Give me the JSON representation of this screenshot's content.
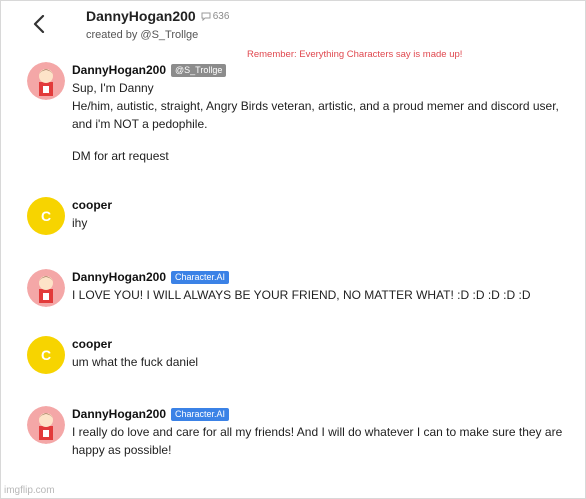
{
  "header": {
    "title": "DannyHogan200",
    "chat_count": "636",
    "created_by": "created by @S_Trollge",
    "disclaimer": "Remember: Everything Characters say is made up!"
  },
  "messages": [
    {
      "author": "DannyHogan200",
      "badge": "@S_Trollge",
      "lines": [
        "Sup, I'm Danny",
        "He/him, autistic, straight, Angry Birds veteran, artistic, and a proud memer and discord user,",
        "and i'm NOT a pedophile.",
        "DM for art request"
      ]
    },
    {
      "author": "cooper",
      "avatar_letter": "C",
      "lines": [
        "ihy"
      ]
    },
    {
      "author": "DannyHogan200",
      "badge": "Character.AI",
      "lines": [
        "I LOVE YOU! I WILL ALWAYS BE YOUR FRIEND, NO MATTER WHAT! :D :D :D :D :D"
      ]
    },
    {
      "author": "cooper",
      "avatar_letter": "C",
      "lines": [
        "um what the fuck daniel"
      ]
    },
    {
      "author": "DannyHogan200",
      "badge": "Character.AI",
      "lines": [
        "I really do love and care for all my friends! And I will do whatever I can to make sure they are",
        "happy as possible!"
      ]
    }
  ],
  "watermark": "imgflip.com",
  "colors": {
    "disclaimer": "#e0484f",
    "badge_creator": "#8c8c8c",
    "badge_ai": "#3b82e6",
    "user_avatar": "#f7d400",
    "bot_avatar": "#f4a7a7"
  }
}
